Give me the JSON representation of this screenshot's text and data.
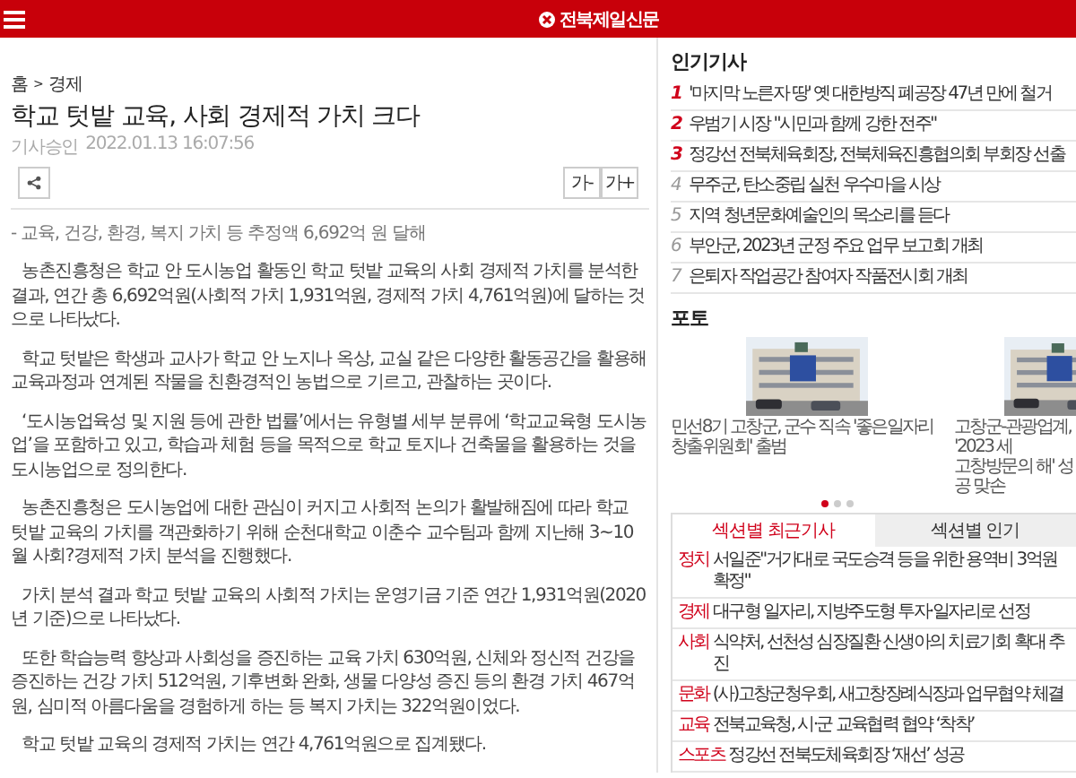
{
  "header": {
    "logo": "전북제일신문"
  },
  "article": {
    "breadcrumb": [
      "홈",
      "경제"
    ],
    "breadcrumb_separator": ">",
    "title": "학교 텃밭 교육, 사회 경제적 가치 크다",
    "date_label": "기사승인",
    "date": "2022.01.13  16:07:56",
    "font_buttons": [
      "가-",
      "가+"
    ],
    "subtitle": "- 교육, 건강, 환경, 복지 가치 등 추정액 6,692억 원 달해",
    "paragraphs": [
      "농촌진흥청은 학교 안 도시농업 활동인 학교 텃밭 교육의 사회 경제적 가치를 분석한 결과, 연간 총 6,692억원(사회적 가치 1,931억원, 경제적 가치 4,761억원)에 달하는 것으로 나타났다.",
      "학교 텃밭은 학생과 교사가 학교 안 노지나 옥상, 교실 같은 다양한 활동공간을 활용해 교육과정과 연계된 작물을 친환경적인 농법으로 기르고, 관찰하는 곳이다.",
      "‘도시농업육성 및 지원 등에 관한 법률’에서는 유형별 세부 분류에 ‘학교교육형 도시농업’을 포함하고 있고, 학습과 체험 등을 목적으로 학교 토지나 건축물을 활용하는 것을 도시농업으로 정의한다.",
      "농촌진흥청은 도시농업에 대한 관심이 커지고 사회적 논의가 활발해짐에 따라 학교 텃밭 교육의 가치를 객관화하기 위해 순천대학교 이춘수 교수팀과 함께 지난해 3~10월 사회?경제적 가치 분석을 진행했다.",
      "가치 분석 결과 학교 텃밭 교육의 사회적 가치는 운영기금 기준 연간 1,931억원(2020년 기준)으로 나타났다.",
      "또한 학습능력 향상과 사회성을 증진하는 교육 가치 630억원, 신체와 정신적 건강을 증진하는 건강 가치 512억원, 기후변화 완화, 생물 다양성 증진 등의 환경 가치 467억원, 심미적 아름다움을 경험하게 하는 등 복지 가치는 322억원이었다.",
      "학교 텃밭 교육의 경제적 가치는 연간 4,761억원으로 집계됐다."
    ]
  },
  "popular": {
    "title": "인기기사",
    "items": [
      {
        "rank": "1",
        "top": true,
        "title": "'마지막 노른자 땅' 옛 대한방직 폐공장 47년 만에 철거"
      },
      {
        "rank": "2",
        "top": true,
        "title": "우범기 시장 \"시민과 함께 강한 전주\""
      },
      {
        "rank": "3",
        "top": true,
        "title": "정강선 전북체육회장, 전북체육진흥협의회 부회장 선출"
      },
      {
        "rank": "4",
        "top": false,
        "title": "무주군, 탄소중립 실천 우수마을 시상"
      },
      {
        "rank": "5",
        "top": false,
        "title": "지역 청년문화예술인의 목소리를 듣다"
      },
      {
        "rank": "6",
        "top": false,
        "title": "부안군, 2023년 군정 주요 업무 보고회 개최"
      },
      {
        "rank": "7",
        "top": false,
        "title": "은퇴자 작업공간 참여자 작품전시회 개최"
      }
    ]
  },
  "photo": {
    "title": "포토",
    "items": [
      {
        "kind": "picture",
        "caption": [
          "민선8기 고창군, 군수 직속 '좋은일자리",
          "창출위원회' 출범"
        ]
      },
      {
        "kind": "picture",
        "caption": [
          "고창군-관광업계, '2023 세",
          "고창방문의 해' 성공 맞손"
        ]
      }
    ],
    "dots": [
      {
        "selected": true
      },
      {
        "selected": false
      },
      {
        "selected": false
      }
    ]
  },
  "section_tabs": [
    {
      "label": "섹션별 최근기사",
      "selected": true
    },
    {
      "label": "섹션별 인기",
      "selected": false
    }
  ],
  "section_news": [
    {
      "category": "정치",
      "title": "서일준\"거가대로 국도승격 등을 위한 용역비 3억원 확정\""
    },
    {
      "category": "경제",
      "title": "대구형 일자리, 지방주도형 투자·일자리로 선정"
    },
    {
      "category": "사회",
      "title": "식약처, 선천성 심장질환 신생아의 치료기회 확대 추진"
    },
    {
      "category": "문화",
      "title": "(사)고창군청우회, 새고창장례식장과 업무협약 체결"
    },
    {
      "category": "교육",
      "title": "전북교육청, 시·군 교육협력 협약 ‘착착’"
    },
    {
      "category": "스포츠",
      "title": "정강선 전북도체육회장 ‘재선’ 성공"
    }
  ]
}
